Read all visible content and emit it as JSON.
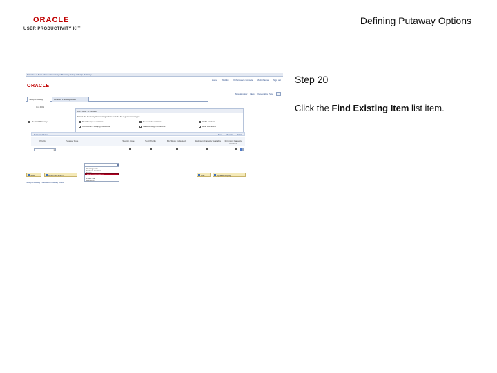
{
  "slide": {
    "logo_brand": "ORACLE",
    "logo_product": "USER PRODUCTIVITY KIT",
    "title": "Defining Putaway Options",
    "step": "Step 20",
    "instruction_prefix": "Click the ",
    "instruction_target": "Find Existing Item",
    "instruction_suffix": " list item."
  },
  "app": {
    "breadcrumbs": "Favorites  >  Main Menu  >  Inventory  >  Putaway Setup  >  Setup Putaway",
    "brand": "ORACLE",
    "nav_links": [
      "Home",
      "Worklist",
      "Performance Console",
      "MultiChannel",
      "Sign out"
    ],
    "header_links": [
      "New Window",
      "Help",
      "Personalize Page"
    ],
    "tabs": [
      "Setup Putaway",
      "Detailed Putaway Rules"
    ],
    "unit_label": "Unit",
    "unit_value": "PO1",
    "rules_box": {
      "title": "Lock Rule To Include",
      "desc": "Select the Putaway Processing rule to include for a given order type:",
      "options": [
        {
          "label": "Non Storage Locations",
          "checked": true
        },
        {
          "label": "Reserved Locations",
          "checked": true
        },
        {
          "label": "VMI Locations",
          "checked": true
        },
        {
          "label": "Cross Dock Staging Locations",
          "checked": false
        },
        {
          "label": "Marked Stage Locations",
          "checked": false
        },
        {
          "label": "Hold Locations",
          "checked": false
        }
      ]
    },
    "restrict_putaway": {
      "label": "Restrict Putaway",
      "checked": true
    },
    "grid": {
      "title": "Putaway Rules",
      "find_label": "Find",
      "view_all_label": "View All",
      "first_label": "First",
      "columns": [
        "Priority",
        "Putaway Rule",
        "Search Zone",
        "Sort Priority",
        "Mix Stock Code Lock",
        "Maximum Capacity Available",
        "Minimum Capacity Available"
      ],
      "row_value": "1"
    },
    "dropdown": {
      "options": [
        "Contingency",
        "Earliest Location",
        "Empty",
        "Fill Fixed",
        "Find Existing Item",
        "Fixed Loc",
        "Random"
      ],
      "highlighted": "Find Existing Item"
    },
    "buttons": [
      "Save",
      "Return to Search",
      "Add",
      "Update/Display"
    ],
    "footer_link": "Setup Putaway | Detailed Putaway Rules"
  }
}
